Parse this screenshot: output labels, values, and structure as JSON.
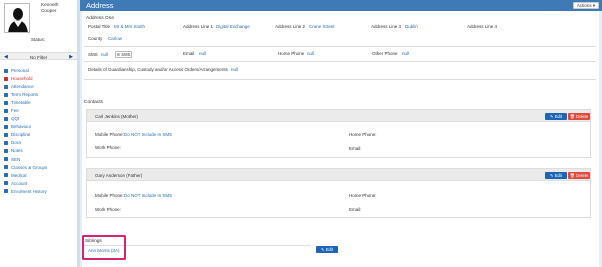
{
  "student": {
    "name_first": "Kenneth",
    "name_last": "Cooper",
    "status_label": "Status:"
  },
  "filter": {
    "label": "No Filter",
    "prev_arrow": "◀",
    "next_arrow": "▶"
  },
  "nav": [
    {
      "label": "Personal",
      "icon": "person-icon",
      "color": "#2a6fb4"
    },
    {
      "label": "Household",
      "icon": "house-icon",
      "color": "#cc2f2f"
    },
    {
      "label": "Attendance",
      "icon": "calendar-icon",
      "color": "#2a6fb4"
    },
    {
      "label": "Term Reports",
      "icon": "report-icon",
      "color": "#2a6fb4"
    },
    {
      "label": "Timetable",
      "icon": "timetable-icon",
      "color": "#2a6fb4"
    },
    {
      "label": "Fee",
      "icon": "money-icon",
      "color": "#2a6fb4"
    },
    {
      "label": "QQI",
      "icon": "certificate-icon",
      "color": "#2a6fb4"
    },
    {
      "label": "Behaviour",
      "icon": "behaviour-icon",
      "color": "#2a6fb4"
    },
    {
      "label": "Discipline",
      "icon": "discipline-icon",
      "color": "#2a6fb4"
    },
    {
      "label": "Docs",
      "icon": "document-icon",
      "color": "#2a6fb4"
    },
    {
      "label": "Notes",
      "icon": "notes-icon",
      "color": "#2a6fb4"
    },
    {
      "label": "SEN",
      "icon": "sen-icon",
      "color": "#2a6fb4"
    },
    {
      "label": "Classes & Groups",
      "icon": "group-icon",
      "color": "#2a6fb4"
    },
    {
      "label": "Medical",
      "icon": "medical-icon",
      "color": "#2a6fb4"
    },
    {
      "label": "Account",
      "icon": "account-icon",
      "color": "#2a6fb4"
    },
    {
      "label": "Enrolment History",
      "icon": "history-icon",
      "color": "#2a6fb4"
    }
  ],
  "header": {
    "title": "Address",
    "actions_label": "Actions ▾"
  },
  "address": {
    "section_title": "Address One",
    "postal_title_label": "Postal Title",
    "postal_title_value": "Mr & Mrs Smith",
    "line1_label": "Address Line 1",
    "line1_value": "Digital Exchange",
    "line2_label": "Address Line 2",
    "line2_value": "Crane Street",
    "line3_label": "Address Line 3",
    "line3_value": "Dublin",
    "line4_label": "Address Line 4",
    "line4_value": "",
    "county_label": "County",
    "county_value": "Carlow"
  },
  "contact_info": {
    "sms_label": "SMS",
    "sms_value": "null",
    "sms_button": "✉ SMS",
    "email_label": "Email",
    "email_value": "null",
    "home_phone_label": "Home Phone",
    "home_phone_value": "null",
    "other_phone_label": "Other Phone",
    "other_phone_value": "null",
    "guardianship_label": "Details of Guardianship, Custody and/or Access Orders/Arrangements",
    "guardianship_value": "null"
  },
  "contacts": {
    "section_title": "Contacts",
    "edit_label": "✎ Edit",
    "delete_label": "🗑 Delete",
    "mobile_label": "Mobile Phone:",
    "work_label": "Work Phone:",
    "home_label": "Home Phone:",
    "email_label": "Email:",
    "items": [
      {
        "name": "Carl Jenkins (Mother)",
        "mobile_value": "Do NOT Include In SMS"
      },
      {
        "name": "Gary Anderson (Father)",
        "mobile_value": "Do NOT Include In SMS"
      }
    ]
  },
  "siblings": {
    "section_title": "Siblings",
    "items": [
      {
        "label": "Ann Morris (3A)"
      }
    ],
    "edit_label": "✎ Edit"
  },
  "colors": {
    "header_bg": "#3e7ab5",
    "link": "#2a6fb4",
    "edit_button": "#1e66b5",
    "delete_button": "#de4a3d",
    "highlight": "#d62570"
  }
}
